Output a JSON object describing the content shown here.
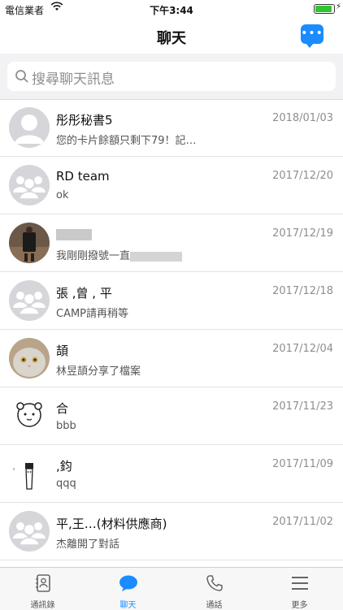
{
  "status_bar": {
    "carrier": "電信業者",
    "time": "下午3:44"
  },
  "nav": {
    "title": "聊天"
  },
  "search": {
    "placeholder": "搜尋聊天訊息"
  },
  "chats": [
    {
      "name": "彤彤秘書5",
      "date": "2018/01/03",
      "preview": "您的卡片餘額只剩下79！記…",
      "avatar": "person-default"
    },
    {
      "name": "RD team",
      "date": "2017/12/20",
      "preview": "ok",
      "avatar": "group-default"
    },
    {
      "name": "",
      "date": "2017/12/19",
      "preview": "我剛剛撥號一直",
      "avatar": "photo"
    },
    {
      "name": "張    ,曾    ,     平",
      "date": "2017/12/18",
      "preview": "CAMP請再稍等",
      "avatar": "group-default"
    },
    {
      "name": "   頡",
      "date": "2017/12/04",
      "preview": "林昱頡分享了檔案",
      "avatar": "cat-photo"
    },
    {
      "name": "   合",
      "date": "2017/11/23",
      "preview": "bbb",
      "avatar": "bear-sticker"
    },
    {
      "name": "   ,鈞",
      "date": "2017/11/09",
      "preview": "qqq",
      "avatar": "figure-sketch"
    },
    {
      "name": "    平,王…(材料供應商)",
      "date": "2017/11/02",
      "preview": "   杰離開了對話",
      "avatar": "group-default"
    }
  ],
  "tabs": [
    {
      "label": "通訊錄",
      "icon": "contacts-icon",
      "active": false
    },
    {
      "label": "聊天",
      "icon": "chat-bubble-icon",
      "active": true
    },
    {
      "label": "通話",
      "icon": "phone-icon",
      "active": false
    },
    {
      "label": "更多",
      "icon": "menu-icon",
      "active": false
    }
  ],
  "colors": {
    "accent": "#1a8cff",
    "battery": "#32c532"
  }
}
